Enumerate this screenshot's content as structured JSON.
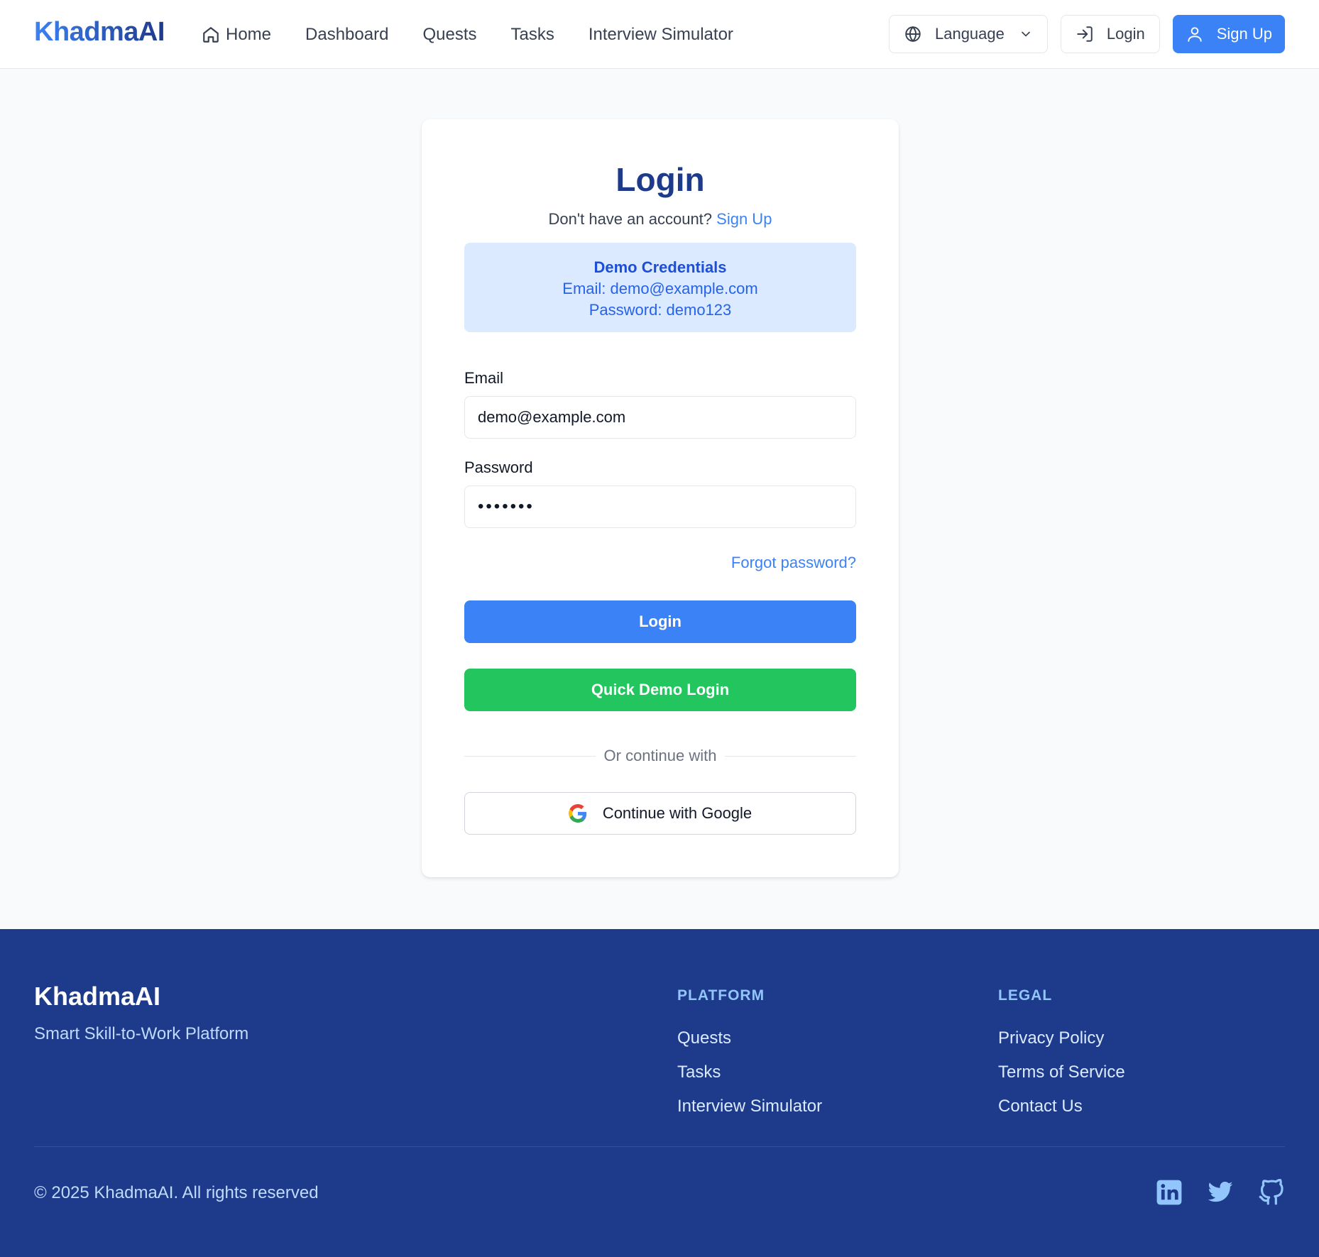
{
  "header": {
    "brand": "KhadmaAI",
    "nav": [
      {
        "label": "Home",
        "icon": "home-icon"
      },
      {
        "label": "Dashboard"
      },
      {
        "label": "Quests"
      },
      {
        "label": "Tasks"
      },
      {
        "label": "Interview Simulator"
      }
    ],
    "language_label": "Language",
    "login_label": "Login",
    "signup_label": "Sign Up"
  },
  "login": {
    "title": "Login",
    "no_account_text": "Don't have an account?",
    "signup_link": "Sign Up",
    "demo": {
      "title": "Demo Credentials",
      "email_line": "Email: demo@example.com",
      "password_line": "Password: demo123"
    },
    "email_label": "Email",
    "email_value": "demo@example.com",
    "password_label": "Password",
    "password_masked": "•••••••",
    "forgot_link": "Forgot password?",
    "login_button": "Login",
    "demo_button": "Quick Demo Login",
    "divider_text": "Or continue with",
    "google_button": "Continue with Google"
  },
  "footer": {
    "brand": "KhadmaAI",
    "tagline": "Smart Skill-to-Work Platform",
    "platform": {
      "heading": "PLATFORM",
      "links": [
        "Quests",
        "Tasks",
        "Interview Simulator"
      ]
    },
    "legal": {
      "heading": "LEGAL",
      "links": [
        "Privacy Policy",
        "Terms of Service",
        "Contact Us"
      ]
    },
    "copyright": "© 2025 KhadmaAI. All rights reserved",
    "social": [
      "linkedin-icon",
      "twitter-icon",
      "github-icon"
    ]
  },
  "colors": {
    "primary": "#3b82f6",
    "brand_dark": "#1e3a8a",
    "success": "#22c55e",
    "demo_bg": "#dbeafe"
  }
}
